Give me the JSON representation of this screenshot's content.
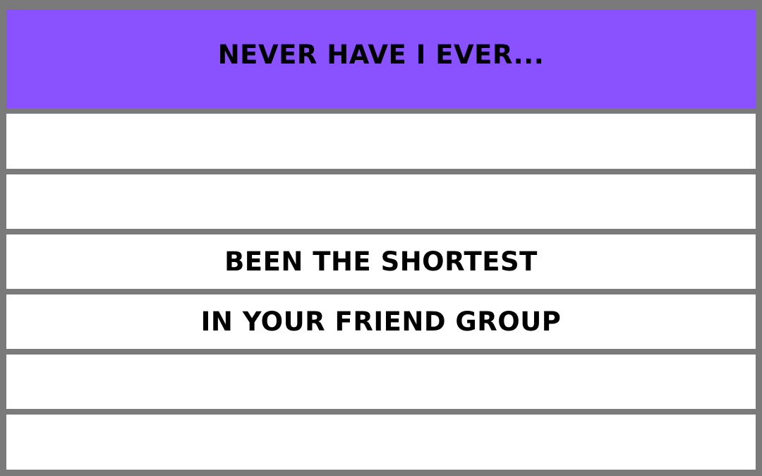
{
  "card": {
    "title": "NEVER HAVE I EVER...",
    "rows": [
      {
        "text": ""
      },
      {
        "text": ""
      },
      {
        "text": "BEEN THE SHORTEST"
      },
      {
        "text": "IN YOUR FRIEND GROUP"
      },
      {
        "text": ""
      },
      {
        "text": ""
      }
    ]
  },
  "colors": {
    "header_bg": "#8a52ff",
    "border": "#7a7a7a",
    "row_bg": "#ffffff",
    "text": "#000000"
  }
}
